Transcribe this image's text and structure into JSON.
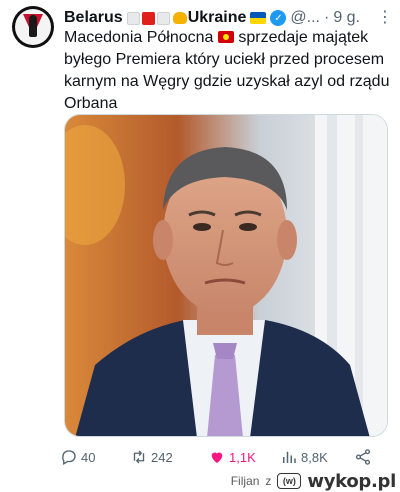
{
  "author": {
    "name": "Belarus",
    "name_suffix": "Ukraine",
    "handle": "@...",
    "time": "9 g.",
    "dot": "·"
  },
  "tweet": {
    "line1_prefix": "Macedonia Północna",
    "line1_suffix": " sprzedaje majątek",
    "rest": "byłego Premiera który uciekł przed procesem karnym na Węgry gdzie uzyskał azyl od rządu Orbana"
  },
  "actions": {
    "replies": "40",
    "retweets": "242",
    "likes": "1,1K",
    "views": "8,8K"
  },
  "footer": {
    "filjan": "Filjan",
    "z": "z",
    "wykop": "wykop.pl",
    "wykop_logo": "(w)"
  },
  "icons": {
    "reply": "reply-icon",
    "retweet": "retweet-icon",
    "like": "heart-icon",
    "views": "views-icon",
    "share": "share-icon",
    "more": "more-icon",
    "verified": "verified-icon"
  },
  "colors": {
    "like_active": "#f91880",
    "verified": "#1d9bf0",
    "secondary_text": "#536471",
    "ukraine_blue": "#0057b7",
    "ukraine_yellow": "#ffd700"
  }
}
